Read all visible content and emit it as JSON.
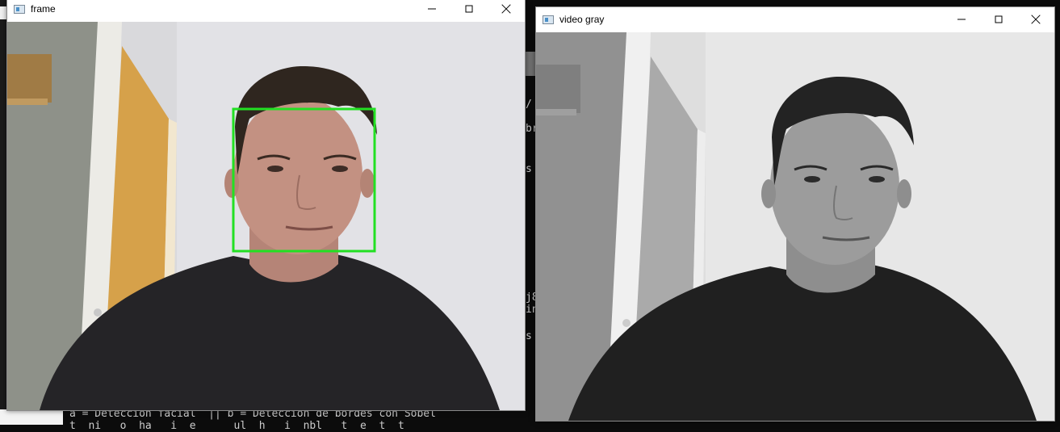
{
  "terminal": {
    "lines": [
      "a = Deteccion facial  || b = Deteccion de bordes con Sobel",
      "t  ni   o  ha   i  e      ul  h   i  nbl   t  e  t  t  "
    ],
    "fragments": [
      "/",
      "br",
      "s",
      "j8",
      "in",
      "s"
    ]
  },
  "windows": {
    "frame": {
      "title": "frame"
    },
    "gray": {
      "title": "video gray"
    }
  },
  "detection": {
    "color": "#22e022",
    "label": "face-detection-box"
  },
  "colors": {
    "terminal_bg": "#0c0c0c",
    "titlebar_bg": "#ffffff"
  }
}
